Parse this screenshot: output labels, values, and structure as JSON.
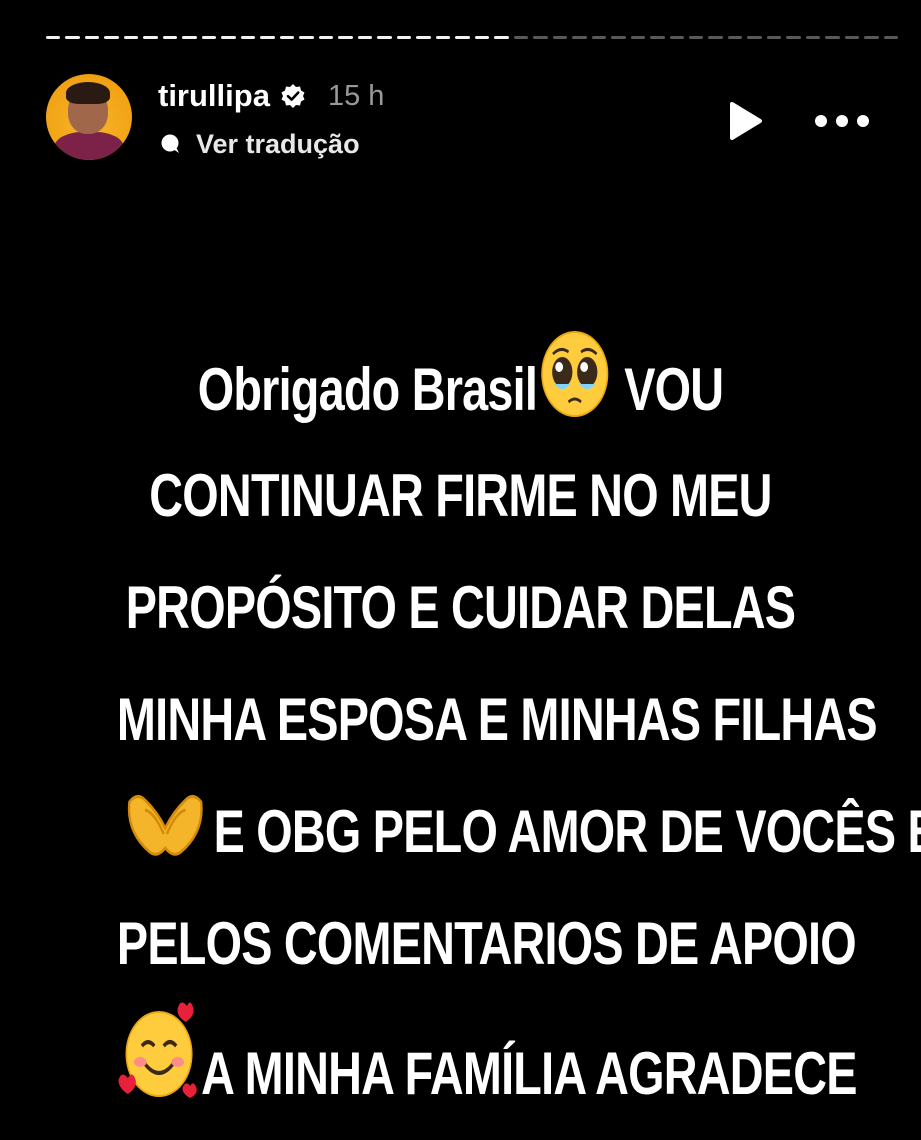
{
  "progress": {
    "segments": [
      1,
      1,
      1,
      1,
      1,
      1,
      1,
      1,
      1,
      1,
      1,
      1,
      1,
      1,
      1,
      1,
      1,
      1,
      1,
      1,
      1,
      1,
      1,
      1,
      0,
      0,
      0,
      0,
      0,
      0,
      0,
      0,
      0,
      0,
      0,
      0,
      0,
      0,
      0,
      0,
      0,
      0,
      0,
      0
    ]
  },
  "header": {
    "username": "tirullipa",
    "time": "15 h",
    "translate_label": "Ver tradução"
  },
  "story": {
    "lines": [
      {
        "pre_emoji": "",
        "text_before": "Obrigado Brasil",
        "emoji": "pleading-face-emoji",
        "text_after": " VOU"
      },
      {
        "pre_emoji": "",
        "text_before": "CONTINUAR FIRME NO MEU",
        "emoji": "",
        "text_after": ""
      },
      {
        "pre_emoji": "",
        "text_before": "PROPÓSITO E CUIDAR DELAS",
        "emoji": "",
        "text_after": ""
      },
      {
        "pre_emoji": "",
        "text_before": "MINHA ESPOSA E MINHAS FILHAS",
        "emoji": "",
        "text_after": ""
      },
      {
        "pre_emoji": "heart-hands-emoji",
        "text_before": "E OBG PELO AMOR DE VOCÊS E",
        "emoji": "",
        "text_after": ""
      },
      {
        "pre_emoji": "",
        "text_before": "PELOS COMENTARIOS DE APOIO",
        "emoji": "",
        "text_after": ""
      },
      {
        "pre_emoji": "smiling-face-with-hearts-emoji",
        "text_before": "A MINHA FAMÍLIA AGRADECE",
        "emoji": "",
        "text_after": ""
      }
    ]
  },
  "colors": {
    "background": "#000000",
    "text": "#ffffff",
    "muted": "#9a9a9a",
    "avatar_bg": "#f2a214"
  }
}
